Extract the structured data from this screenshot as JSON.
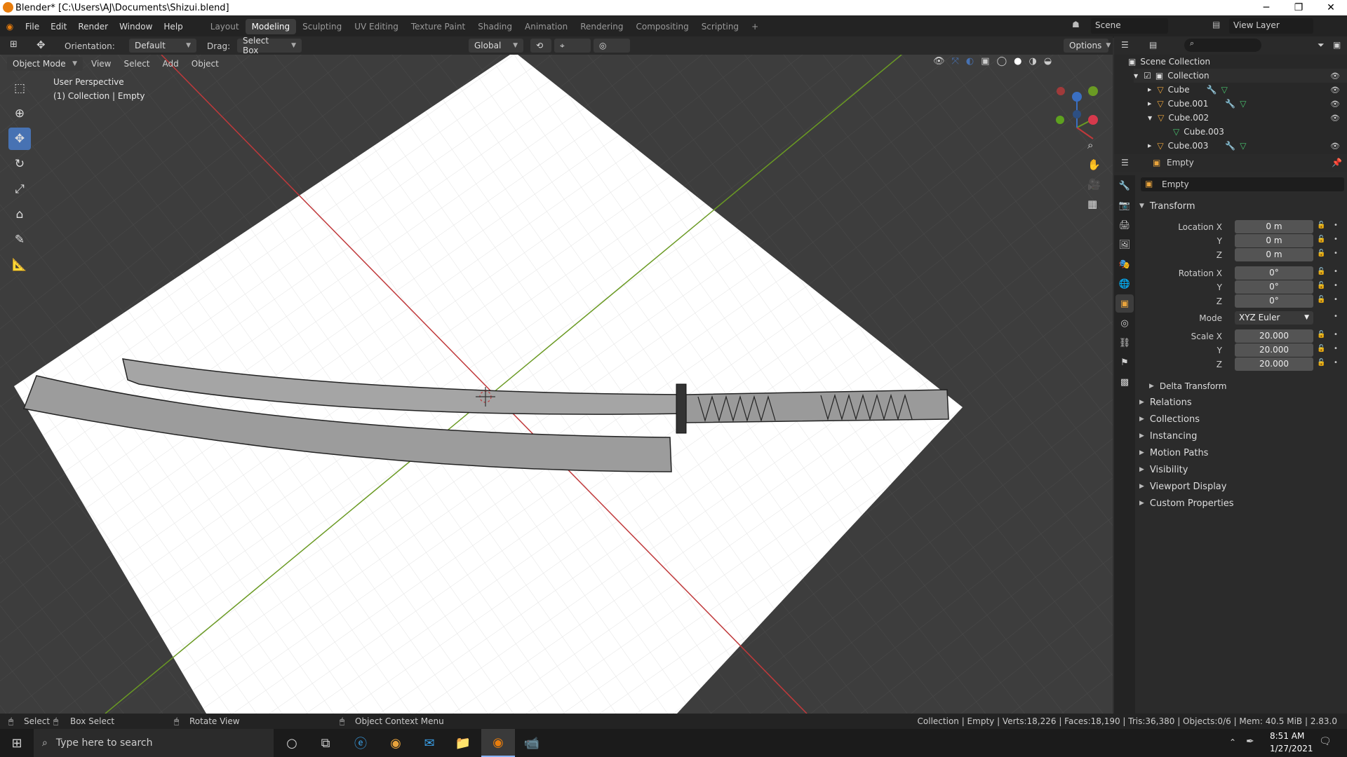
{
  "window": {
    "title": "Blender* [C:\\Users\\AJ\\Documents\\Shizui.blend]"
  },
  "menu": {
    "file": "File",
    "edit": "Edit",
    "render": "Render",
    "window": "Window",
    "help": "Help"
  },
  "workspaces": [
    "Layout",
    "Modeling",
    "Sculpting",
    "UV Editing",
    "Texture Paint",
    "Shading",
    "Animation",
    "Rendering",
    "Compositing",
    "Scripting"
  ],
  "active_workspace": "Modeling",
  "scene": {
    "label": "Scene",
    "view_layer": "View Layer"
  },
  "toolbar": {
    "orientation_label": "Orientation:",
    "orientation_value": "Default",
    "drag_label": "Drag:",
    "drag_value": "Select Box",
    "transform_orientation": "Global",
    "options": "Options"
  },
  "viewport_header": {
    "mode": "Object Mode",
    "view": "View",
    "select": "Select",
    "add": "Add",
    "object": "Object"
  },
  "viewport": {
    "perspective": "User Perspective",
    "context": "(1) Collection | Empty"
  },
  "outliner": {
    "root": "Scene Collection",
    "collection": "Collection",
    "items": [
      {
        "name": "Cube"
      },
      {
        "name": "Cube.001"
      },
      {
        "name": "Cube.002"
      },
      {
        "name": "Cube.003",
        "child": true
      },
      {
        "name": "Cube.003"
      }
    ]
  },
  "properties": {
    "object_name": "Empty",
    "data_name": "Empty",
    "transform": "Transform",
    "location": {
      "x_label": "Location X",
      "y_label": "Y",
      "z_label": "Z",
      "x": "0 m",
      "y": "0 m",
      "z": "0 m"
    },
    "rotation": {
      "x_label": "Rotation X",
      "y_label": "Y",
      "z_label": "Z",
      "x": "0°",
      "y": "0°",
      "z": "0°"
    },
    "mode_label": "Mode",
    "mode_value": "XYZ Euler",
    "scale": {
      "x_label": "Scale X",
      "y_label": "Y",
      "z_label": "Z",
      "x": "20.000",
      "y": "20.000",
      "z": "20.000"
    },
    "delta": "Delta Transform",
    "sections": [
      "Relations",
      "Collections",
      "Instancing",
      "Motion Paths",
      "Visibility",
      "Viewport Display",
      "Custom Properties"
    ]
  },
  "status": {
    "select": "Select",
    "box_select": "Box Select",
    "rotate_view": "Rotate View",
    "context_menu": "Object Context Menu",
    "stats": "Collection | Empty | Verts:18,226 | Faces:18,190 | Tris:36,380 | Objects:0/6 | Mem: 40.5 MiB | 2.83.0"
  },
  "taskbar": {
    "search_placeholder": "Type here to search",
    "time": "8:51 AM",
    "date": "1/27/2021"
  },
  "colors": {
    "accent": "#4772b3",
    "x_axis": "#c0393b",
    "y_axis": "#6a9a23",
    "blender_orange": "#e87d0d"
  }
}
